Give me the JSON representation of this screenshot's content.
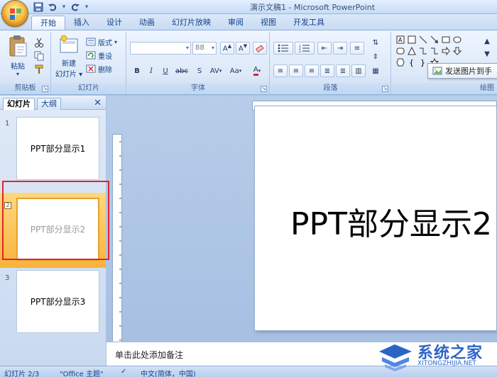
{
  "app": {
    "window_title": "演示文稿1 - Microsoft PowerPoint"
  },
  "tabs": [
    "开始",
    "插入",
    "设计",
    "动画",
    "幻灯片放映",
    "审阅",
    "视图",
    "开发工具"
  ],
  "ribbon": {
    "clipboard": {
      "label": "剪贴板",
      "paste": "粘贴"
    },
    "slides": {
      "label": "幻灯片",
      "new_slide_line1": "新建",
      "new_slide_line2": "幻灯片",
      "layout": "版式",
      "reset": "重设",
      "delete": "删除"
    },
    "font": {
      "label": "字体",
      "font_size": "88"
    },
    "paragraph": {
      "label": "段落"
    },
    "drawing": {
      "label": "绘图"
    }
  },
  "tooltip": {
    "text": "发送图片到手"
  },
  "panel": {
    "tab_slides": "幻灯片",
    "tab_outline": "大纲",
    "slides": [
      {
        "num": "1",
        "text": "PPT部分显示1"
      },
      {
        "num": "2",
        "text": "PPT部分显示2"
      },
      {
        "num": "3",
        "text": "PPT部分显示3"
      }
    ]
  },
  "main": {
    "slide_title": "PPT部分显示2",
    "notes_placeholder": "单击此处添加备注"
  },
  "status": {
    "slide_index": "幻灯片 2/3",
    "theme": "\"Office 主题\"",
    "language": "中文(简体，中国)"
  },
  "watermark": {
    "main": "系统之家",
    "sub": "XITONGZHIJIA.NET"
  },
  "colors": {
    "ribbon_text": "#15428b",
    "selection": "#f8b33b",
    "highlight_box": "#e0252d"
  }
}
